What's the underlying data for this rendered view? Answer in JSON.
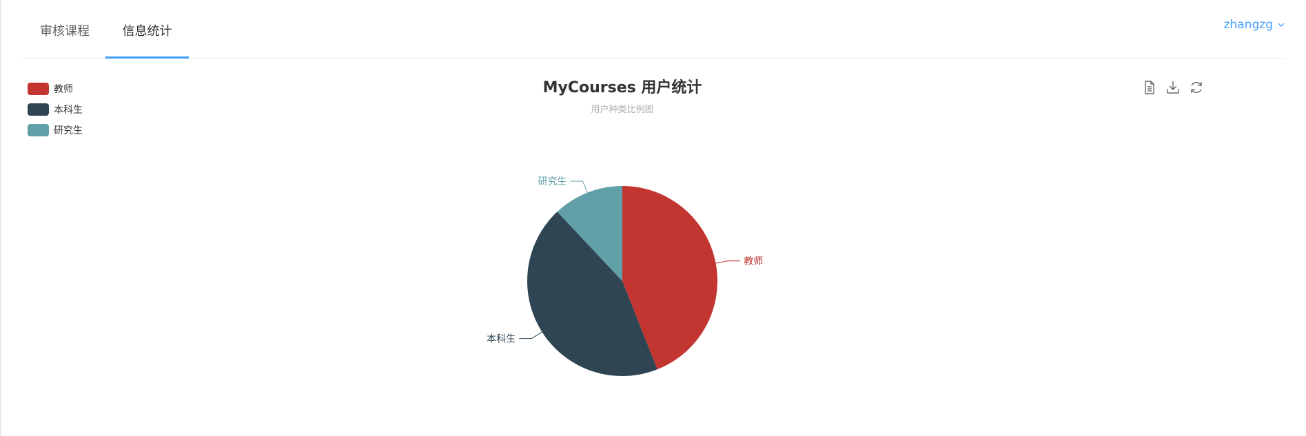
{
  "tabs": [
    {
      "label": "审核课程"
    },
    {
      "label": "信息统计"
    }
  ],
  "active_tab": 1,
  "user": {
    "name": "zhangzg"
  },
  "toolbox": {
    "icons": [
      "data-view-icon",
      "save-image-icon",
      "restore-icon"
    ]
  },
  "chart_data": {
    "type": "pie",
    "title": "MyCourses 用户统计",
    "subtitle": "用户种类比例图",
    "legend_position": "top-left",
    "categories": [
      "教师",
      "本科生",
      "研究生"
    ],
    "values": [
      44,
      44,
      12
    ],
    "colors": [
      "#c23531",
      "#2f4554",
      "#61a0a8"
    ]
  }
}
